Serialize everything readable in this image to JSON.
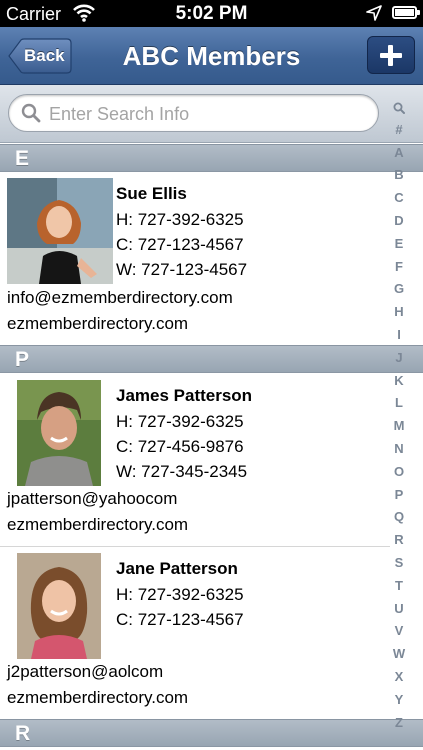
{
  "status_bar": {
    "carrier": "Carrier",
    "time": "5:02 PM"
  },
  "navbar": {
    "back_label": "Back",
    "title": "ABC Members",
    "add_icon": "plus-icon"
  },
  "search": {
    "placeholder": "Enter Search Info",
    "icon": "magnifier-icon"
  },
  "sections": [
    {
      "letter": "E",
      "members": [
        {
          "name": "Sue  Ellis",
          "home": "H: 727-392-6325",
          "cell": "C: 727-123-4567",
          "work": "W: 727-123-4567",
          "email": "info@ezmemberdirectory.com",
          "website": "ezmemberdirectory.com"
        }
      ]
    },
    {
      "letter": "P",
      "members": [
        {
          "name": "James  Patterson",
          "home": "H: 727-392-6325",
          "cell": "C: 727-456-9876",
          "work": "W: 727-345-2345",
          "email": "jpatterson@yahoocom",
          "website": "ezmemberdirectory.com"
        },
        {
          "name": "Jane  Patterson",
          "home": "H: 727-392-6325",
          "cell": "C: 727-123-4567",
          "email": "j2patterson@aolcom",
          "website": "ezmemberdirectory.com"
        }
      ]
    },
    {
      "letter": "R",
      "members": []
    }
  ],
  "index": [
    "#",
    "A",
    "B",
    "C",
    "D",
    "E",
    "F",
    "G",
    "H",
    "I",
    "J",
    "K",
    "L",
    "M",
    "N",
    "O",
    "P",
    "Q",
    "R",
    "S",
    "T",
    "U",
    "V",
    "W",
    "X",
    "Y",
    "Z"
  ],
  "colors": {
    "navbar": "#3f6497",
    "section_header": "#a5b0bc",
    "index_text": "#7b8796"
  }
}
